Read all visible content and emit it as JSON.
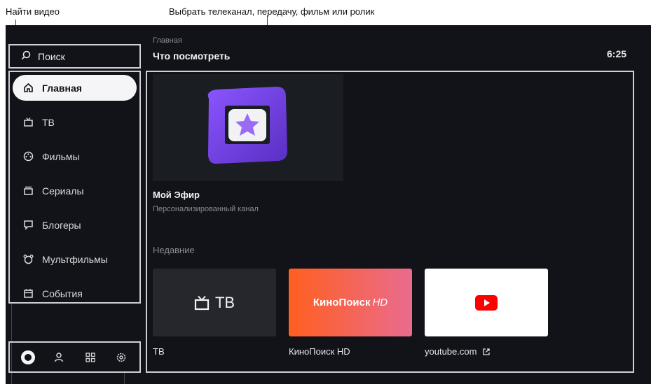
{
  "annotations": {
    "find_video": "Найти видео",
    "choose_channel": "Выбрать телеканал, передачу, фильм или ролик"
  },
  "search": {
    "label": "Поиск",
    "icon": "search-icon"
  },
  "menu": {
    "items": [
      {
        "label": "Главная",
        "icon": "home-icon",
        "active": true
      },
      {
        "label": "ТВ",
        "icon": "tv-icon"
      },
      {
        "label": "Фильмы",
        "icon": "film-reel-icon"
      },
      {
        "label": "Сериалы",
        "icon": "stack-icon"
      },
      {
        "label": "Блогеры",
        "icon": "chat-bubble-icon"
      },
      {
        "label": "Мультфильмы",
        "icon": "cartoon-face-icon"
      },
      {
        "label": "События",
        "icon": "calendar-icon"
      }
    ]
  },
  "bottom_bar": {
    "icons": [
      "alice-icon",
      "profile-icon",
      "apps-grid-icon",
      "settings-gear-icon"
    ]
  },
  "header": {
    "breadcrumb": "Главная",
    "title": "Что посмотреть",
    "time": "6:25"
  },
  "hero": {
    "name": "Мой Эфир",
    "subtitle": "Персонализированный канал",
    "accent": "#6b3fd6"
  },
  "recent": {
    "heading": "Недавние",
    "tiles": [
      {
        "caption": "ТВ",
        "art_text": "ТВ",
        "bg": "#26272d"
      },
      {
        "caption": "КиноПоиск HD",
        "art_text": "КиноПоиск",
        "art_badge": "HD",
        "bg": "#f06a3a"
      },
      {
        "caption": "youtube.com",
        "bg": "#ffffff",
        "external_icon": "external-link-icon"
      }
    ]
  }
}
